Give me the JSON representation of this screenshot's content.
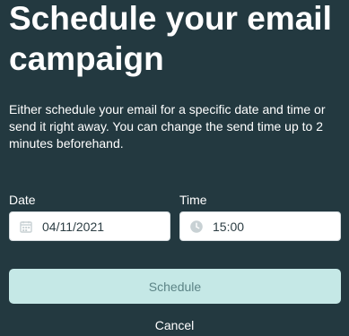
{
  "title": "Schedule your email campaign",
  "description": "Either schedule your email for a specific date and time or send it right away. You can change the send time up to 2 minutes beforehand.",
  "date": {
    "label": "Date",
    "value": "04/11/2021",
    "icon": "calendar-icon"
  },
  "time": {
    "label": "Time",
    "value": "15:00",
    "icon": "clock-icon"
  },
  "actions": {
    "schedule_label": "Schedule",
    "cancel_label": "Cancel"
  },
  "colors": {
    "background": "#233940",
    "button_bg": "#C5E8E6",
    "button_text": "#5C8486",
    "field_bg": "#FFFFFF",
    "text_primary": "#FFFFFF"
  }
}
